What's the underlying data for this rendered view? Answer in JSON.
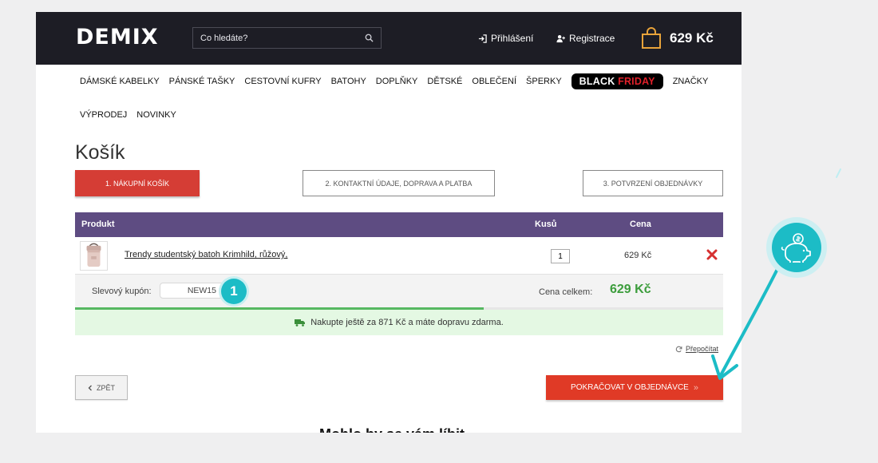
{
  "header": {
    "logo": "DEMIX",
    "search_placeholder": "Co hledáte?",
    "login": "Přihlášení",
    "register": "Registrace",
    "cart_total": "629 Kč"
  },
  "nav": {
    "row1": [
      "DÁMSKÉ KABELKY",
      "PÁNSKÉ TAŠKY",
      "CESTOVNÍ KUFRY",
      "BATOHY",
      "DOPLŇKY",
      "DĚTSKÉ",
      "OBLEČENÍ",
      "ŠPERKY"
    ],
    "black_friday_a": "BLACK",
    "black_friday_b": "FRIDAY",
    "brands": "ZNAČKY",
    "row2": [
      "VÝPRODEJ",
      "NOVINKY"
    ]
  },
  "page_title": "Košík",
  "steps": [
    "1. NÁKUPNÍ KOŠÍK",
    "2. KONTAKTNÍ ÚDAJE, DOPRAVA A PLATBA",
    "3. POTVRZENÍ OBJEDNÁVKY"
  ],
  "table": {
    "headers": {
      "product": "Produkt",
      "qty": "Kusů",
      "price": "Cena"
    },
    "items": [
      {
        "name": "Trendy studentský batoh Krimhild, růžový,",
        "qty": "1",
        "price": "629 Kč"
      }
    ]
  },
  "coupon": {
    "label": "Slevový kupón:",
    "value": "NEW15",
    "badge": "1"
  },
  "total": {
    "label": "Cena celkem:",
    "value": "629 Kč"
  },
  "shipping": {
    "note": "Nakupte ještě za 871 Kč a máte dopravu zdarma.",
    "progress_percent": 63
  },
  "recalc": "Přepočítat",
  "buttons": {
    "back": "ZPĚT",
    "continue": "POKRAČOVAT V OBJEDNÁVCE"
  },
  "cut_heading": "Mohlo by se vám líbit",
  "colors": {
    "header_bg": "#1d1d25",
    "step_active": "#d53d35",
    "table_head": "#5e4c82",
    "total_green": "#3c9d3c",
    "accent_teal": "#1cbcc6",
    "continue_red": "#e03a26"
  }
}
